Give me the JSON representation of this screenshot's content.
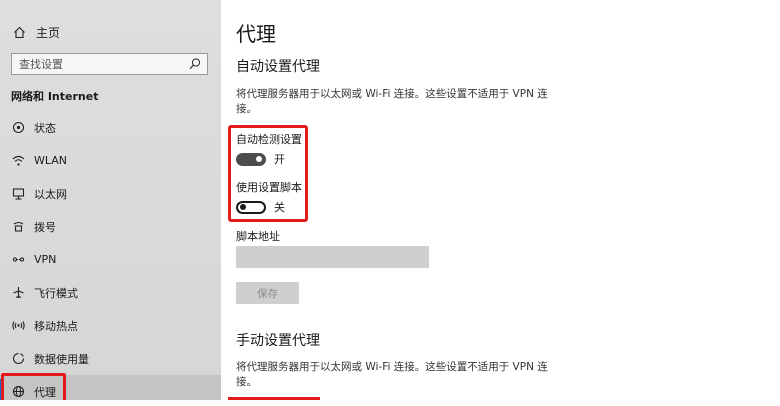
{
  "sidebar": {
    "home_label": "主页",
    "search_placeholder": "查找设置",
    "section_title": "网络和 Internet",
    "items": [
      {
        "label": "状态",
        "icon": "status-icon"
      },
      {
        "label": "WLAN",
        "icon": "wifi-icon"
      },
      {
        "label": "以太网",
        "icon": "ethernet-icon"
      },
      {
        "label": "拨号",
        "icon": "dialup-icon"
      },
      {
        "label": "VPN",
        "icon": "vpn-icon"
      },
      {
        "label": "飞行模式",
        "icon": "airplane-icon"
      },
      {
        "label": "移动热点",
        "icon": "hotspot-icon"
      },
      {
        "label": "数据使用量",
        "icon": "data-usage-icon"
      },
      {
        "label": "代理",
        "icon": "globe-icon",
        "active": true
      }
    ]
  },
  "main": {
    "title": "代理",
    "auto_section": {
      "heading": "自动设置代理",
      "description": "将代理服务器用于以太网或 Wi-Fi 连接。这些设置不适用于 VPN 连接。",
      "auto_detect_label": "自动检测设置",
      "auto_detect_state": "开",
      "auto_detect_on": true,
      "use_script_label": "使用设置脚本",
      "use_script_state": "关",
      "use_script_on": false,
      "script_address_label": "脚本地址",
      "script_address_value": "",
      "save_label": "保存"
    },
    "manual_section": {
      "heading": "手动设置代理",
      "description": "将代理服务器用于以太网或 Wi-Fi 连接。这些设置不适用于 VPN 连接。"
    }
  },
  "colors": {
    "highlight": "#e31a1a",
    "accent": "#0b6fce",
    "sidebar_bg": "#d8d8d8"
  }
}
